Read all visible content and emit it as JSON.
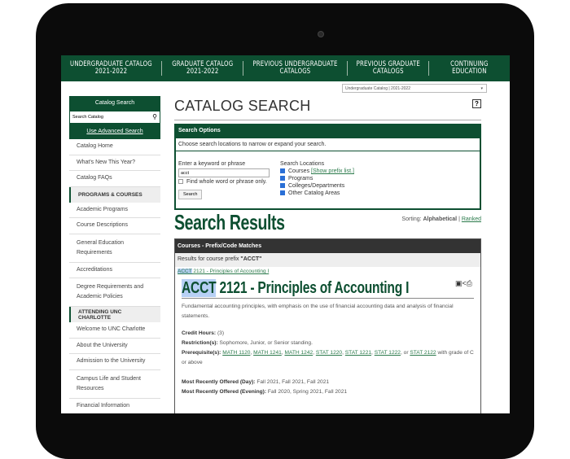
{
  "nav": [
    "UNDERGRADUATE CATALOG\n2021-2022",
    "GRADUATE CATALOG\n2021-2022",
    "PREVIOUS UNDERGRADUATE\nCATALOGS",
    "PREVIOUS GRADUATE\nCATALOGS",
    "CONTINUING\nEDUCATION"
  ],
  "catalog_select": "Undergraduate Catalog | 2021-2022",
  "sidebar": {
    "head": "Catalog Search",
    "search_placeholder": "Search Catalog",
    "advanced": "Use Advanced Search",
    "items": [
      {
        "t": "Catalog Home"
      },
      {
        "t": "What's New This Year?"
      },
      {
        "t": "Catalog FAQs"
      },
      {
        "t": "PROGRAMS & COURSES",
        "h": true
      },
      {
        "t": "Academic Programs"
      },
      {
        "t": "Course Descriptions"
      },
      {
        "t": "General Education Requirements",
        "two": true
      },
      {
        "t": "Accreditations"
      },
      {
        "t": "Degree Requirements and Academic Policies",
        "two": true
      },
      {
        "t": "ATTENDING UNC CHARLOTTE",
        "h": true
      },
      {
        "t": "Welcome to UNC Charlotte"
      },
      {
        "t": "About the University"
      },
      {
        "t": "Admission to the University"
      },
      {
        "t": "Campus Life and Student Resources",
        "two": true
      },
      {
        "t": "Financial Information"
      }
    ]
  },
  "page_title": "CATALOG SEARCH",
  "help": "?",
  "options": {
    "head": "Search Options",
    "sub": "Choose search locations to narrow or expand your search.",
    "keyword_label": "Enter a keyword or phrase",
    "keyword": "acct",
    "whole_word": "Find whole word or phrase only.",
    "search_btn": "Search",
    "locations_label": "Search Locations",
    "locations": [
      {
        "label": "Courses",
        "checked": true,
        "link": "[Show prefix list.]"
      },
      {
        "label": "Programs",
        "checked": true
      },
      {
        "label": "Colleges/Departments",
        "checked": true
      },
      {
        "label": "Other Catalog Areas",
        "checked": true
      }
    ]
  },
  "results_title": "Search Results",
  "sorting": {
    "label": "Sorting:",
    "current": "Alphabetical",
    "sep": "|",
    "other": "Ranked"
  },
  "panel": {
    "head": "Courses - Prefix/Code Matches",
    "sub_prefix": "Results for course prefix ",
    "sub_value": "\"ACCT\"",
    "link_prefix": "ACCT",
    "link_rest": " 2121 - Principles of Accounting I",
    "course_prefix": "ACCT",
    "course_rest": " 2121 - Principles of Accounting I",
    "description": "Fundamental accounting principles, with emphasis on the use of financial accounting data and analysis of financial statements.",
    "credit_label": "Credit Hours:",
    "credit": " (3)",
    "restriction_label": "Restriction(s):",
    "restriction": " Sophomore, Junior, or Senior standing.",
    "prereq_label": "Prerequisite(s):",
    "prereqs": [
      "MATH 1120",
      "MATH 1241",
      "MATH 1242",
      "STAT 1220",
      "STAT 1221",
      "STAT 1222",
      "STAT 2122"
    ],
    "prereq_tail": " with grade of C or above",
    "day_label": "Most Recently Offered (Day):",
    "day": " Fall 2021, Fall 2021, Fall 2021",
    "evening_label": "Most Recently Offered (Evening):",
    "evening": " Fall 2020, Spring 2021, Fall 2021"
  },
  "colors": {
    "brand": "#0d4f31",
    "link": "#2b7a4b",
    "highlight": "#b7d0f5"
  }
}
